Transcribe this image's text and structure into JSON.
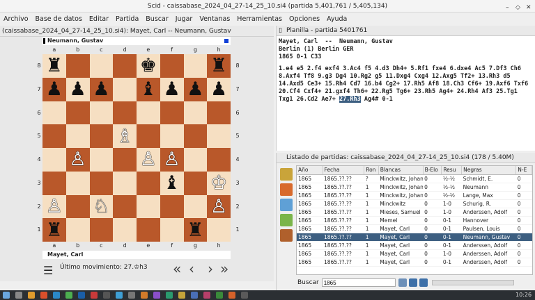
{
  "window": {
    "title": "Scid - caissabase_2024_04_27-14_25_10.si4 (partida 5,401,761 / 5,405,134)"
  },
  "menu": [
    "Archivo",
    "Base de datos",
    "Editar",
    "Partida",
    "Buscar",
    "Jugar",
    "Ventanas",
    "Herramientas",
    "Opciones",
    "Ayuda"
  ],
  "left_pane": {
    "header": "(caissabase_2024_04_27-14_25_10.si4): Mayet, Carl -- Neumann, Gustav"
  },
  "board": {
    "top_player": "Neumann, Gustav",
    "bottom_player": "Mayet, Carl",
    "files": [
      "a",
      "b",
      "c",
      "d",
      "e",
      "f",
      "g",
      "h"
    ],
    "ranks": [
      "8",
      "7",
      "6",
      "5",
      "4",
      "3",
      "2",
      "1"
    ],
    "position": [
      [
        "♜",
        "",
        "",
        "",
        "♚",
        "",
        "",
        "♜"
      ],
      [
        "♟",
        "♟",
        "♟",
        "",
        "♝",
        "♟",
        "♟",
        "♟"
      ],
      [
        "",
        "",
        "",
        "",
        "",
        "",
        "",
        ""
      ],
      [
        "",
        "",
        "",
        "♗",
        "",
        "",
        "",
        ""
      ],
      [
        "",
        "♙",
        "",
        "",
        "♙",
        "♙",
        "",
        ""
      ],
      [
        "",
        "",
        "",
        "",
        "",
        "♝",
        "",
        "♔"
      ],
      [
        "♙",
        "",
        "",
        "",
        "",
        "",
        "",
        "♙"
      ],
      [
        "♜",
        "",
        "",
        "",
        "",
        "",
        "♜",
        ""
      ]
    ],
    "piece_colors": [
      [
        "b",
        "",
        "",
        "",
        "b",
        "",
        "",
        "b"
      ],
      [
        "b",
        "b",
        "b",
        "",
        "b",
        "b",
        "b",
        "b"
      ],
      [
        "",
        "",
        "",
        "",
        "",
        "",
        "",
        ""
      ],
      [
        "",
        "",
        "",
        "w",
        "",
        "",
        "",
        ""
      ],
      [
        "",
        "w",
        "",
        "",
        "w",
        "w",
        "",
        ""
      ],
      [
        "",
        "",
        "",
        "",
        "",
        "b",
        "",
        "w"
      ],
      [
        "w",
        "",
        "",
        "",
        "",
        "",
        "",
        "w"
      ],
      [
        "b",
        "",
        "",
        "",
        "",
        "",
        "b",
        ""
      ]
    ],
    "last_move_label": "Último movimiento: 27.♔h3",
    "nav": {
      "first": "«",
      "prev": "‹",
      "next": "›",
      "last": "»"
    }
  },
  "knight_c2": "♘",
  "pgn_pane": {
    "header": "Planilla - partida 5401761",
    "white": "Mayet, Carl",
    "sep": "--",
    "black": "Neumann, Gustav",
    "event": "Berlin (1)  Berlin GER",
    "info": "1865  0-1  C33",
    "moves_main": "1.e4 e5 2.f4 exf4 3.Ac4 f5 4.d3 Dh4+ 5.Rf1 fxe4 6.dxe4 Ac5 7.Df3 Ch6 8.Axf4 Tf8 9.g3 Dg4 10.Rg2 g5 11.Dxg4 Cxg4 12.Axg5 Tf2+ 13.Rh3 d5 14.Axd5 Ce3+ 15.Rh4 Cd7 16.b4 Cg2+ 17.Rh5 Af8 18.Ch3 Cf6+ 19.Axf6 Txf6 20.Cf4 Cxf4+ 21.gxf4 Th6+ 22.Rg5 Tg6+ 23.Rh5 Ag4+ 24.Rh4 Af3 25.Tg1 Txg1 26.Cd2 Ae7+",
    "moves_current": "27.Rh3",
    "moves_tail": "Ag4# 0-1"
  },
  "game_list": {
    "header": "Listado de partidas: caissabase_2024_04_27-14_25_10.si4 (178 / 5.40M)",
    "columns": [
      "Año",
      "Fecha",
      "Ron",
      "Blancas",
      "B-Elo",
      "Resu",
      "Negras",
      "N-E"
    ],
    "rows": [
      [
        "1865",
        "1865.??.??",
        "?",
        "Minckwitz, Johann",
        "0",
        "½-½",
        "Schmidt, E.",
        "0"
      ],
      [
        "1865",
        "1865.??.??",
        "1",
        "Minckwitz, Johann",
        "0",
        "½-½",
        "Neumann",
        "0"
      ],
      [
        "1865",
        "1865.??.??",
        "1",
        "Minckwitz, Johann",
        "0",
        "½-½",
        "Lange, Max",
        "0"
      ],
      [
        "1865",
        "1865.??.??",
        "1",
        "Minckwitz",
        "0",
        "1-0",
        "Schurig, R.",
        "0"
      ],
      [
        "1865",
        "1865.??.??",
        "1",
        "Mieses, Samuel",
        "0",
        "1-0",
        "Anderssen, Adolf",
        "0"
      ],
      [
        "1865",
        "1865.??.??",
        "1",
        "Memel",
        "0",
        "0-1",
        "Hannover",
        "0"
      ],
      [
        "1865",
        "1865.??.??",
        "1",
        "Mayet, Carl",
        "0",
        "0-1",
        "Paulsen, Louis",
        "0"
      ],
      [
        "1865",
        "1865.??.??",
        "1",
        "Mayet, Carl",
        "0",
        "0-1",
        "Neumann, Gustav",
        "0"
      ],
      [
        "1865",
        "1865.??.??",
        "1",
        "Mayet, Carl",
        "0",
        "0-1",
        "Anderssen, Adolf",
        "0"
      ],
      [
        "1865",
        "1865.??.??",
        "1",
        "Mayet, Carl",
        "0",
        "1-0",
        "Anderssen, Adolf",
        "0"
      ],
      [
        "1865",
        "1865.??.??",
        "1",
        "Mayet, Carl",
        "0",
        "0-1",
        "Anderssen, Adolf",
        "0"
      ]
    ],
    "selected_row": 7,
    "search_label": "Buscar",
    "search_value": "1865"
  },
  "taskbar": {
    "clock": "10:26"
  }
}
